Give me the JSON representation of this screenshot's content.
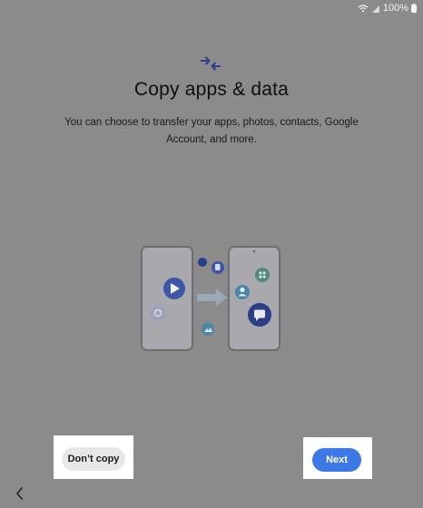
{
  "status_bar": {
    "battery_text": "100%",
    "icons": [
      "wifi-icon",
      "signal-icon",
      "battery-icon"
    ]
  },
  "header": {
    "icon": "transfer-arrows-icon",
    "title": "Copy apps & data",
    "subtitle": "You can choose to transfer your apps, photos, contacts, Google Account, and more."
  },
  "illustration": {
    "icon": "phone-transfer-illustration"
  },
  "actions": {
    "dont_copy_label": "Don’t copy",
    "next_label": "Next"
  },
  "nav": {
    "back_icon": "chevron-left-icon"
  },
  "colors": {
    "background": "#8b8b8b",
    "accent": "#3c78e6",
    "secondary_button": "#e8e8ea",
    "illustration_blue": "#3f55a5"
  }
}
